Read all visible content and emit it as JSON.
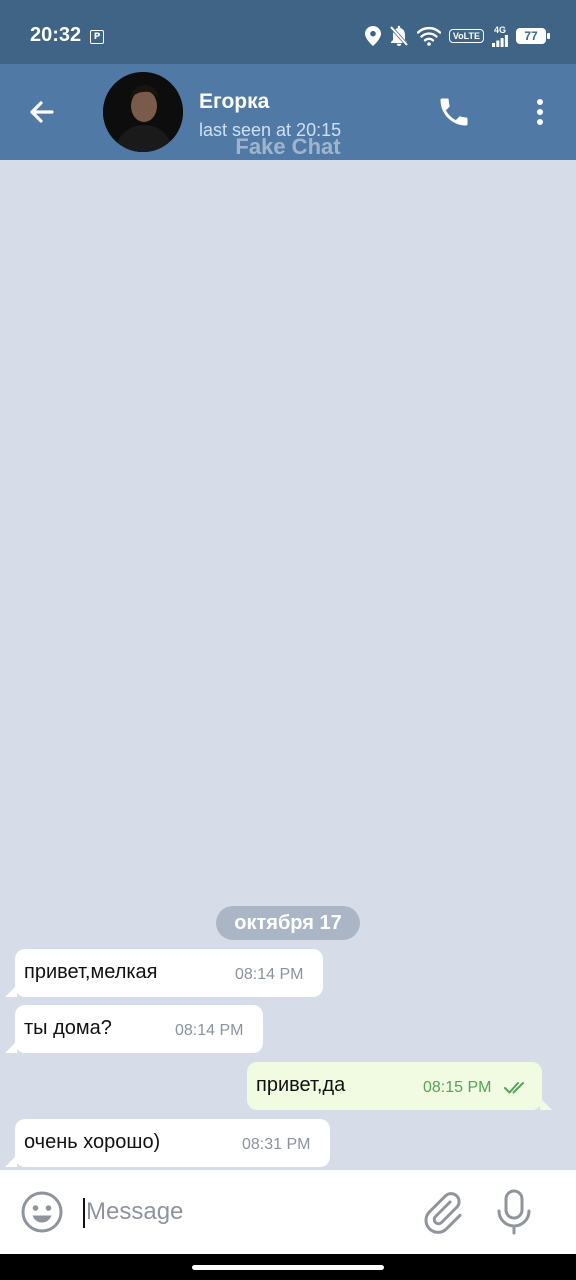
{
  "status_bar": {
    "time": "20:32",
    "volte": "VoLTE",
    "network": "4G",
    "battery": "77"
  },
  "header": {
    "contact_name": "Егорка",
    "last_seen": "last seen at 20:15",
    "watermark": "Fake Chat",
    "icons": [
      "back-arrow-icon",
      "phone-icon",
      "more-vertical-icon"
    ]
  },
  "chat": {
    "date_label": "октября 17",
    "messages": [
      {
        "direction": "incoming",
        "text": "привет,мелкая",
        "time": "08:14 PM"
      },
      {
        "direction": "incoming",
        "text": "ты дома?",
        "time": "08:14 PM"
      },
      {
        "direction": "outgoing",
        "text": "привет,да",
        "time": "08:15 PM",
        "status": "read"
      },
      {
        "direction": "incoming",
        "text": "очень хорошо)",
        "time": "08:31 PM"
      }
    ]
  },
  "input": {
    "placeholder": "Message",
    "value": ""
  },
  "colors": {
    "status_bar": "#3f6486",
    "header": "#5079a6",
    "chat_bg": "#d6dde8",
    "incoming_bubble": "#ffffff",
    "outgoing_bubble": "#f0fbe2",
    "read_check": "#5aa05a"
  }
}
